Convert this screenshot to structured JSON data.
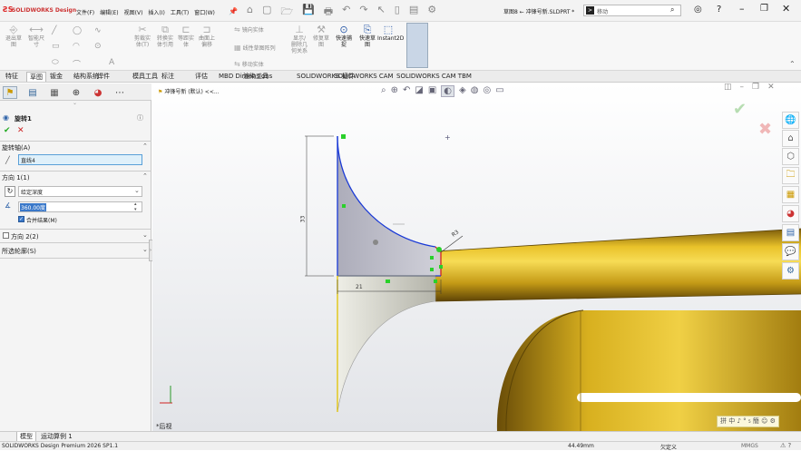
{
  "titlebar": {
    "brand": "SOLIDWORKS Design",
    "menus": [
      "文件(F)",
      "编辑(E)",
      "视图(V)",
      "插入(I)",
      "工具(T)",
      "窗口(W)"
    ],
    "doc_title": "草图8 ← 冲锋号新.SLDPRT *",
    "search_placeholder": "移动"
  },
  "ribbon": {
    "buttons": [
      {
        "label": "退出草\n图",
        "enabled": false
      },
      {
        "label": "智能尺\n寸",
        "enabled": false
      },
      {
        "label": "剪裁实\n体(T)",
        "enabled": false
      },
      {
        "label": "转换实\n体引用",
        "enabled": false
      },
      {
        "label": "等距实\n体",
        "enabled": false
      },
      {
        "label": "曲面上\n偏移",
        "enabled": false
      },
      {
        "label": "镜向实体",
        "enabled": false
      },
      {
        "label": "线性草图阵列",
        "enabled": false
      },
      {
        "label": "移动实体",
        "enabled": false
      },
      {
        "label": "显示/\n删除几\n何关系",
        "enabled": false
      },
      {
        "label": "修复草\n图",
        "enabled": false
      },
      {
        "label": "快速捕\n捉",
        "enabled": true
      },
      {
        "label": "快速草\n图",
        "enabled": true
      },
      {
        "label": "Instant2D",
        "enabled": true
      },
      {
        "label": "上色草\n图轮廓",
        "enabled": true
      }
    ]
  },
  "tabs": [
    "特征",
    "草图",
    "钣金",
    "结构系统",
    "焊件",
    "模具工具",
    "标注",
    "评估",
    "MBD Dimensions",
    "渲染工具",
    "SOLIDWORKS 插件",
    "SOLIDWORKS CAM",
    "SOLIDWORKS CAM TBM"
  ],
  "active_tab": "草图",
  "tree": {
    "breadcrumb": "冲锋号新 (默认) <<..."
  },
  "property": {
    "title": "旋转1",
    "axis_section": "旋转轴(A)",
    "axis_value": "直线4",
    "dir1_section": "方向 1(1)",
    "end_condition": "给定深度",
    "angle": "360.00度",
    "merge_label": "合并结果(M)",
    "dir2_section": "方向 2(2)",
    "contours_section": "所选轮廓(S)"
  },
  "viewport": {
    "view_label": "*后视",
    "dim_left": "33",
    "dim_bottom": "21",
    "dim_diag": "R3"
  },
  "bottom_tabs": [
    "模型",
    "运动算例 1"
  ],
  "status": {
    "product": "SOLIDWORKS Design Premium 2026 SP1.1",
    "measure": "44.49mm",
    "mode": "欠定义",
    "units": "MMGS"
  },
  "ime": "拼 中 ♪ ° ₅ 簡 ☺ ⚙"
}
